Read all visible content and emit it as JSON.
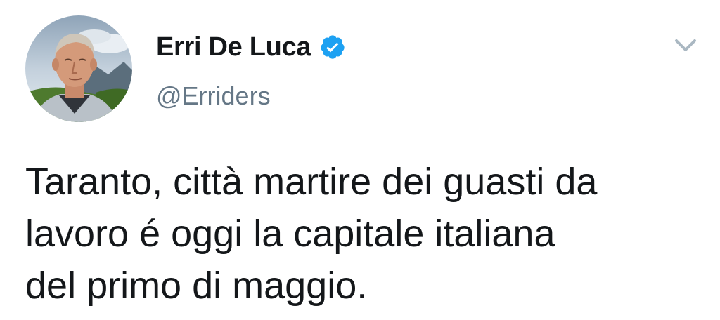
{
  "tweet": {
    "author": {
      "display_name": "Erri De Luca",
      "handle": "@Erriders",
      "verified": true,
      "avatar_icon": "profile-photo"
    },
    "text_lines": [
      "Taranto, città martire dei guasti da",
      "lavoro é oggi la capitale italiana",
      "del primo di maggio."
    ],
    "menu_icon": "chevron-down-icon"
  },
  "colors": {
    "text": "#14171a",
    "secondary": "#657786",
    "verified_badge": "#1da1f2",
    "chevron": "#aab8c2"
  }
}
